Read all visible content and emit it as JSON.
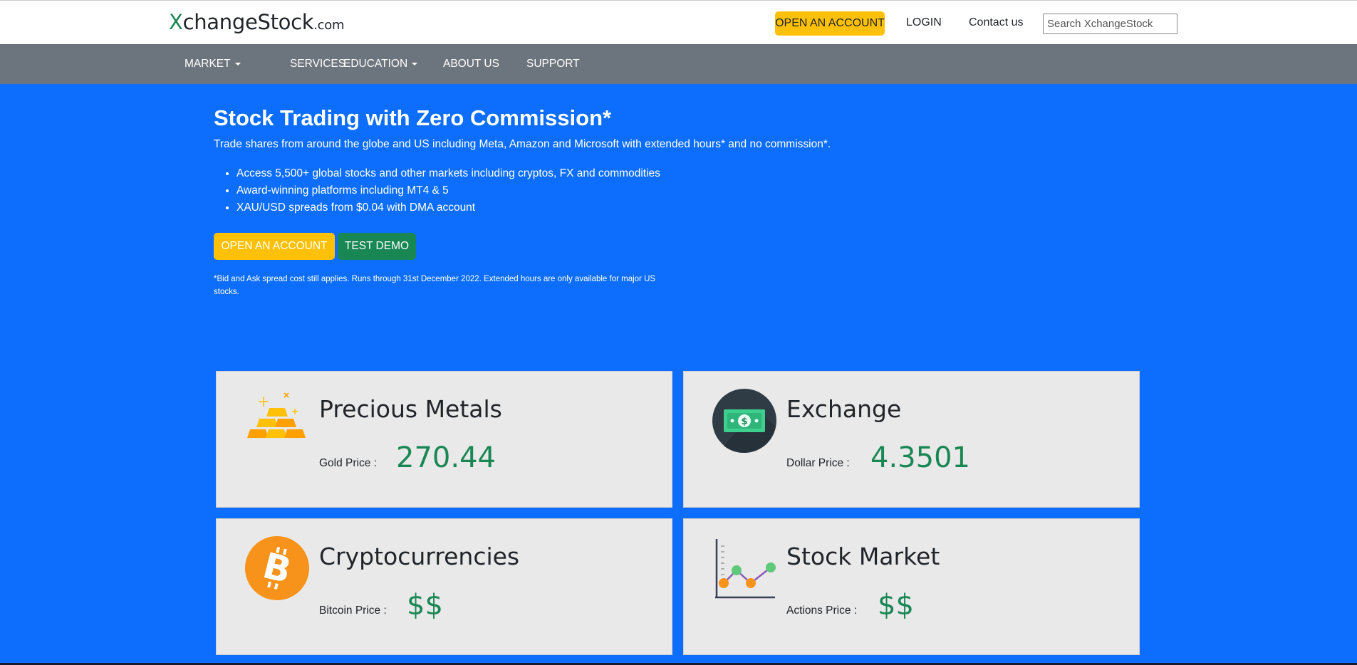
{
  "header": {
    "logo_x": "X",
    "logo_rest": "changeStock",
    "logo_domain": ".com",
    "open_account": "OPEN AN ACCOUNT",
    "login": "LOGIN",
    "contact": "Contact us",
    "search_placeholder": "Search XchangeStock"
  },
  "nav": {
    "items": [
      {
        "label": "MARKET",
        "dropdown": true
      },
      {
        "label": "SERVICES",
        "dropdown": false
      },
      {
        "label": "EDUCATION",
        "dropdown": true
      },
      {
        "label": "ABOUT US",
        "dropdown": false
      },
      {
        "label": "SUPPORT",
        "dropdown": false
      }
    ]
  },
  "hero": {
    "title": "Stock Trading with Zero Commission*",
    "subtitle": "Trade shares from around the globe and US including Meta, Amazon and Microsoft with extended hours* and no commission*.",
    "bullets": [
      "Access 5,500+ global stocks and other markets including cryptos, FX and commodities",
      "Award-winning platforms including MT4 & 5",
      "XAU/USD spreads from $0.04 with DMA account"
    ],
    "open_account": "OPEN AN ACCOUNT",
    "test_demo": "TEST DEMO",
    "disclaimer": "*Bid and Ask spread cost still applies. Runs through 31st December 2022. Extended hours are only available for major US stocks."
  },
  "cards": [
    {
      "title": "Precious Metals",
      "label": "Gold Price :",
      "value": "270.44",
      "icon": "gold-bars-icon"
    },
    {
      "title": "Exchange",
      "label": "Dollar Price :",
      "value": "4.3501",
      "icon": "dollar-bill-icon"
    },
    {
      "title": "Cryptocurrencies",
      "label": "Bitcoin Price :",
      "value": "$$",
      "icon": "bitcoin-icon"
    },
    {
      "title": "Stock Market",
      "label": "Actions Price :",
      "value": "$$",
      "icon": "line-chart-icon"
    }
  ],
  "colors": {
    "primary": "#0d6efd",
    "warning": "#ffc107",
    "success": "#198754",
    "nav": "#6c757d",
    "card": "#e9e9e9"
  }
}
